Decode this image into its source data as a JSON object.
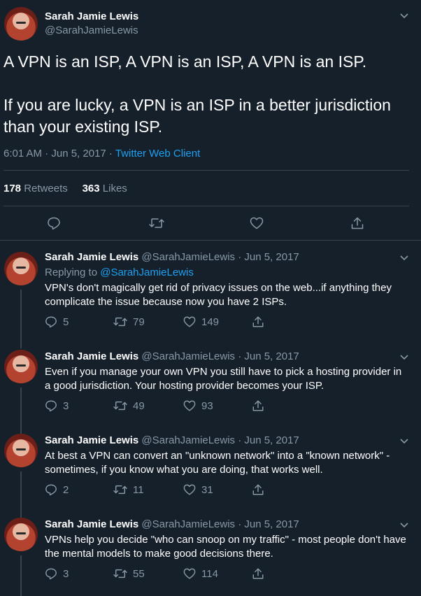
{
  "main_tweet": {
    "name": "Sarah Jamie Lewis",
    "handle": "@SarahJamieLewis",
    "text": "A VPN is an ISP, A VPN is an ISP, A VPN is an ISP.\n\nIf you are lucky, a VPN is an ISP in a better jurisdiction than your existing ISP.",
    "timestamp": "6:01 AM · Jun 5, 2017 · ",
    "client": "Twitter Web Client",
    "retweets_count": "178",
    "retweets_label": "Retweets",
    "likes_count": "363",
    "likes_label": "Likes"
  },
  "replies": [
    {
      "name": "Sarah Jamie Lewis",
      "meta": "@SarahJamieLewis · Jun 5, 2017",
      "replying_prefix": "Replying to ",
      "replying_to": "@SarahJamieLewis",
      "text": "VPN's don't magically get rid of privacy issues on the web...if anything they complicate the issue because now you have 2 ISPs.",
      "reply_count": "5",
      "retweet_count": "79",
      "like_count": "149"
    },
    {
      "name": "Sarah Jamie Lewis",
      "meta": "@SarahJamieLewis · Jun 5, 2017",
      "text": "Even if you manage your own VPN you still have to pick a hosting provider in a good jurisdiction. Your hosting provider becomes your ISP.",
      "reply_count": "3",
      "retweet_count": "49",
      "like_count": "93"
    },
    {
      "name": "Sarah Jamie Lewis",
      "meta": "@SarahJamieLewis · Jun 5, 2017",
      "text": "At best a VPN can convert an \"unknown network\" into a \"known network\" - sometimes, if you know what you are doing, that works well.",
      "reply_count": "2",
      "retweet_count": "11",
      "like_count": "31"
    },
    {
      "name": "Sarah Jamie Lewis",
      "meta": "@SarahJamieLewis · Jun 5, 2017",
      "text": "VPNs help you decide \"who can snoop on my traffic\" - most people don't have the mental models to make good decisions there.",
      "reply_count": "3",
      "retweet_count": "55",
      "like_count": "114"
    }
  ],
  "icons": {
    "reply": "reply-icon",
    "retweet": "retweet-icon",
    "like": "heart-icon",
    "share": "share-icon",
    "more": "chevron-down-icon"
  },
  "colors": {
    "background": "#15202b",
    "text": "#ffffff",
    "muted": "#8899a6",
    "link": "#1da1f2",
    "divider": "#38444d"
  }
}
